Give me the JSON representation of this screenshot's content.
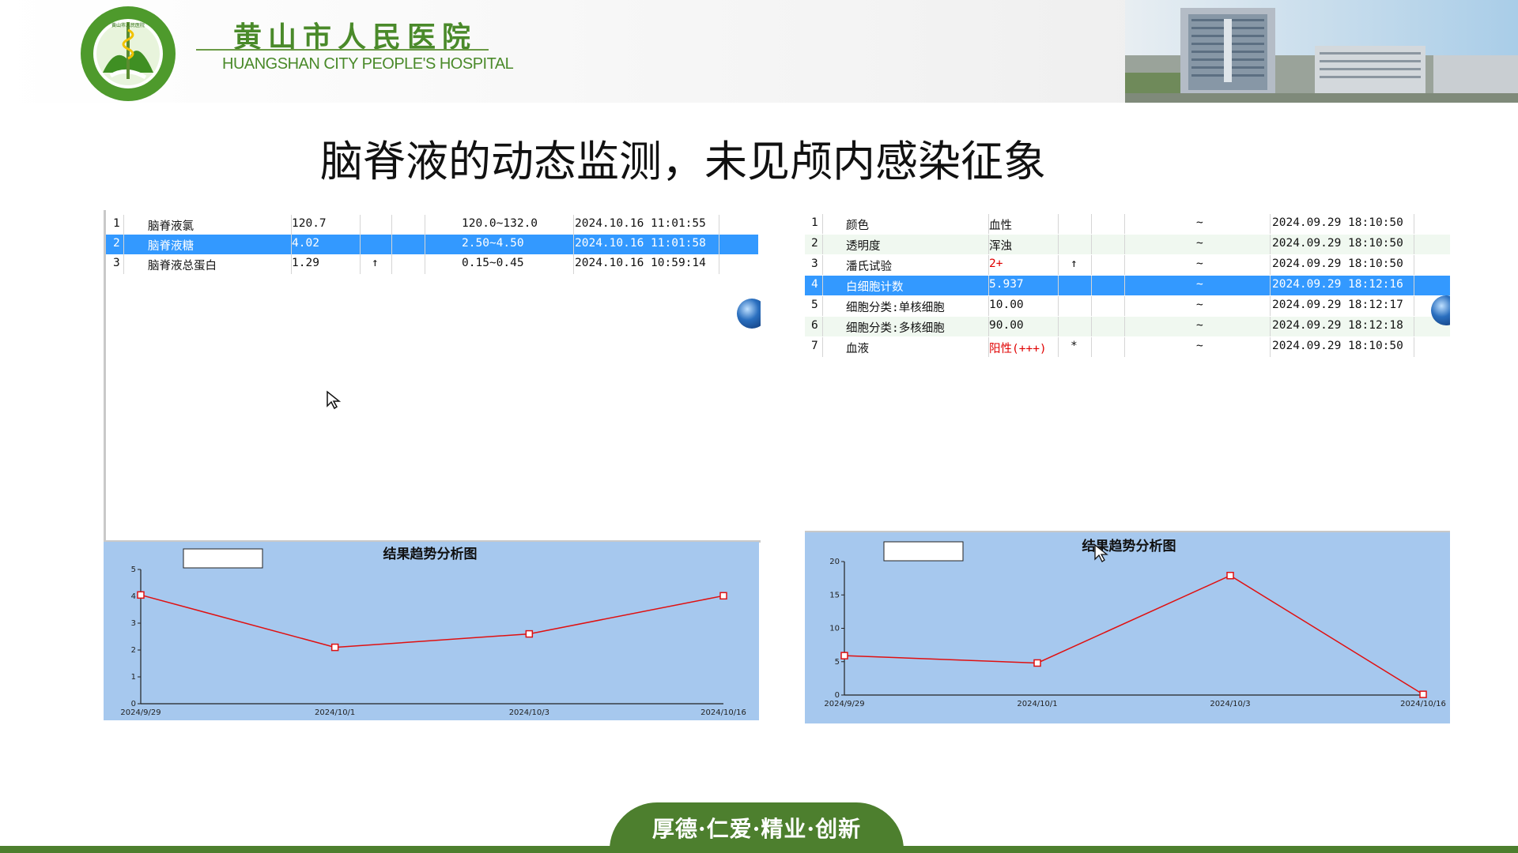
{
  "header": {
    "hospital_name_cn": "黄山市人民医院",
    "hospital_name_en": "HUANGSHAN CITY PEOPLE'S HOSPITAL",
    "logo_ring_text": "THE PEOPLE'S HOSPITAL OF HUANGSHAN",
    "logo_ring_text_cn": "黄山市人民医院"
  },
  "title": "脑脊液的动态监测，未见颅内感染征象",
  "left_table": {
    "rows": [
      {
        "no": "1",
        "name": "脑脊液氯",
        "value": "120.7",
        "flag": "",
        "range": "120.0~132.0",
        "time": "2024.10.16 11:01:55",
        "selected": false
      },
      {
        "no": "2",
        "name": "脑脊液糖",
        "value": "4.02",
        "flag": "",
        "range": "2.50~4.50",
        "time": "2024.10.16 11:01:58",
        "selected": true
      },
      {
        "no": "3",
        "name": "脑脊液总蛋白",
        "value": "1.29",
        "flag": "↑",
        "range": "0.15~0.45",
        "time": "2024.10.16 10:59:14",
        "selected": false
      }
    ]
  },
  "right_table": {
    "rows": [
      {
        "no": "1",
        "name": "颜色",
        "value": "血性",
        "value_red": false,
        "flag": "",
        "range": "~",
        "time": "2024.09.29 18:10:50",
        "selected": false
      },
      {
        "no": "2",
        "name": "透明度",
        "value": "浑浊",
        "value_red": false,
        "flag": "",
        "range": "~",
        "time": "2024.09.29 18:10:50",
        "selected": false
      },
      {
        "no": "3",
        "name": "潘氏试验",
        "value": "2+",
        "value_red": true,
        "flag": "↑",
        "range": "~",
        "time": "2024.09.29 18:10:50",
        "selected": false
      },
      {
        "no": "4",
        "name": "白细胞计数",
        "value": "5.937",
        "value_red": false,
        "flag": "",
        "range": "~",
        "time": "2024.09.29 18:12:16",
        "selected": true
      },
      {
        "no": "5",
        "name": "细胞分类:单核细胞",
        "value": "10.00",
        "value_red": false,
        "flag": "",
        "range": "~",
        "time": "2024.09.29 18:12:17",
        "selected": false
      },
      {
        "no": "6",
        "name": "细胞分类:多核细胞",
        "value": "90.00",
        "value_red": false,
        "flag": "",
        "range": "~",
        "time": "2024.09.29 18:12:18",
        "selected": false
      },
      {
        "no": "7",
        "name": "血液",
        "value": "阳性(+++)",
        "value_red": true,
        "flag": "*",
        "range": "~",
        "time": "2024.09.29 18:10:50",
        "selected": false
      }
    ]
  },
  "chart_data": [
    {
      "type": "line",
      "title": "结果趋势分析图",
      "categories": [
        "2024/9/29",
        "2024/10/1",
        "2024/10/3",
        "2024/10/16"
      ],
      "values": [
        4.05,
        2.1,
        2.6,
        4.02
      ],
      "yticks": [
        "0",
        "1",
        "2",
        "3",
        "4",
        "5"
      ],
      "ylim": [
        0,
        5
      ],
      "line_color": "#e01010",
      "background": "#a6c8ee"
    },
    {
      "type": "line",
      "title": "结果趋势分析图",
      "categories": [
        "2024/9/29",
        "2024/10/1",
        "2024/10/3",
        "2024/10/16"
      ],
      "values": [
        5.9,
        4.8,
        17.9,
        0.1
      ],
      "yticks": [
        "0",
        "5",
        "10",
        "15",
        "20"
      ],
      "ylim": [
        0,
        20
      ],
      "line_color": "#e01010",
      "background": "#a6c8ee"
    }
  ],
  "footer": {
    "motto": "厚德·仁爱·精业·创新"
  },
  "colors": {
    "brand_green": "#4d7f2e",
    "selection_blue": "#3399ff",
    "chart_bg": "#a6c8ee"
  }
}
